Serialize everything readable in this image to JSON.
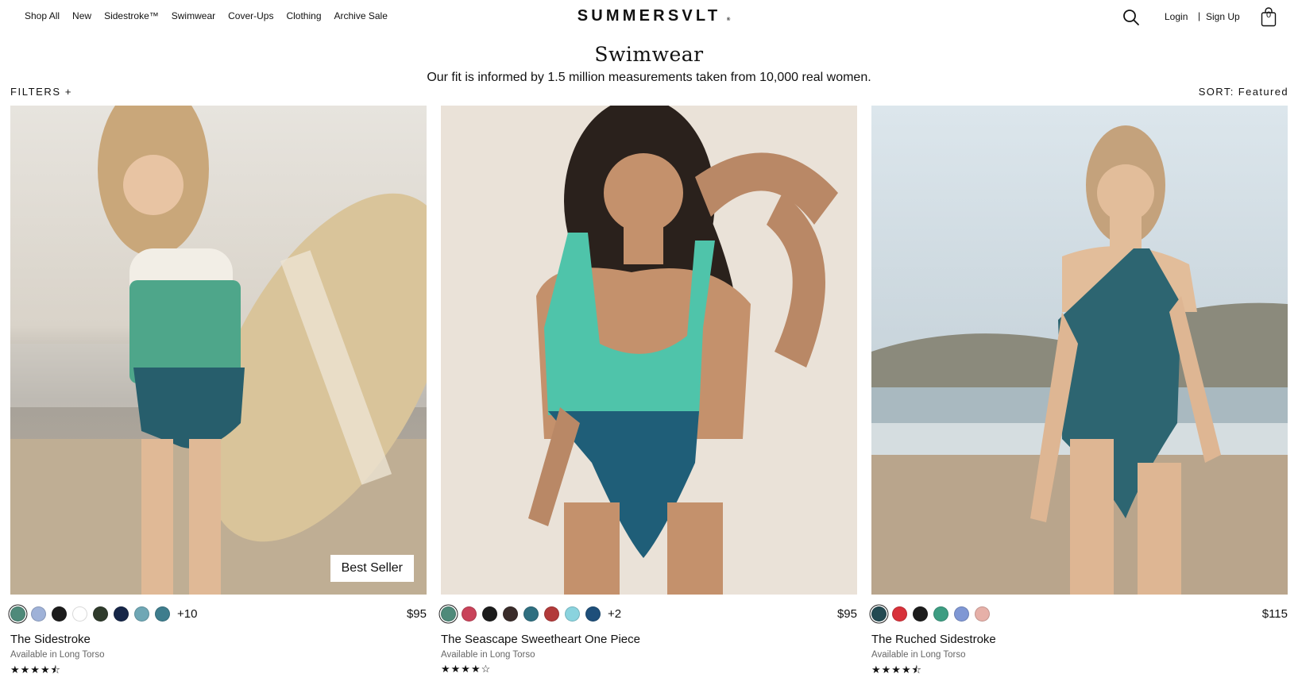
{
  "nav": {
    "links": [
      "Shop All",
      "New",
      "Sidestroke™",
      "Swimwear",
      "Cover-Ups",
      "Clothing",
      "Archive Sale"
    ],
    "logo": "SUMMERSVLT",
    "logo_mark": "®",
    "login": "Login",
    "separator": "|",
    "signup": "Sign Up",
    "cart_count": "0"
  },
  "header": {
    "title": "Swimwear",
    "subtitle": "Our fit is informed by 1.5 million measurements taken from 10,000 real women."
  },
  "toolbar": {
    "filters": "FILTERS +",
    "sort": "SORT: Featured"
  },
  "products": [
    {
      "name": "The Sidestroke",
      "availability": "Available in Long Torso",
      "price": "$95",
      "badge": "Best Seller",
      "more_colors": "+10",
      "rating": 4.5,
      "stars": "★★★★⯪",
      "swatches": [
        "#4f8a7a",
        "#9fb2d8",
        "#1c1c1c",
        "#ffffff",
        "#2f3b2c",
        "#162648",
        "#6fa7b5",
        "#3e7d8d"
      ],
      "photo_colors": {
        "bg_top": "#e3e0d9",
        "bg_bottom": "#b9ab97",
        "suit_top": "#f2eee6",
        "suit_mid": "#4ea68a",
        "suit_bottom": "#275e6c",
        "board": "#d8c49a"
      }
    },
    {
      "name": "The Seascape Sweetheart One Piece",
      "availability": "Available in Long Torso",
      "price": "$95",
      "badge": "",
      "more_colors": "+2",
      "rating": 4,
      "stars": "★★★★☆",
      "swatches": [
        "#4f8a7a",
        "#c9435a",
        "#1c1c1c",
        "#3a2c2a",
        "#2f6f80",
        "#b23a3a",
        "#8ad3de",
        "#1e4f7a"
      ],
      "photo_colors": {
        "bg_top": "#ece4da",
        "bg_bottom": "#e2d8cc",
        "suit_top": "#4fc4aa",
        "suit_bottom": "#1f5e78"
      }
    },
    {
      "name": "The Ruched Sidestroke",
      "availability": "Available in Long Torso",
      "price": "$115",
      "badge": "",
      "more_colors": "",
      "rating": 4.5,
      "stars": "★★★★⯪",
      "swatches": [
        "#234a52",
        "#d8313a",
        "#1c1c1c",
        "#3d9d82",
        "#7f97d4",
        "#e6b0a8"
      ],
      "photo_colors": {
        "bg_top": "#d7e3ea",
        "bg_bottom": "#b9a58c",
        "suit": "#2d6571"
      }
    }
  ]
}
